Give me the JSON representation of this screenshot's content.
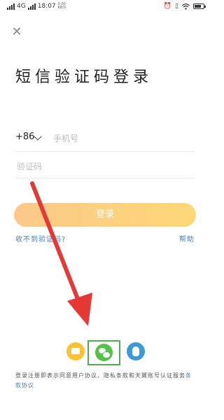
{
  "status_bar": {
    "network": "4G",
    "network_small": "0.00",
    "speed_unit": "KB/S",
    "time": "18:07"
  },
  "title": "短信验证码登录",
  "phone": {
    "country_code": "+86",
    "placeholder": "手机号"
  },
  "code": {
    "placeholder": "验证码"
  },
  "login_button": "登录",
  "links": {
    "no_code": "收不到验证码?",
    "help": "帮助"
  },
  "social": {
    "icons": [
      "mail-icon",
      "wechat-icon",
      "qq-icon"
    ],
    "highlight_color": "#4caf50"
  },
  "agreement": {
    "prefix": "登录注册即表示同意用户协议、隐私条款和天翼账号认证服务",
    "suffix": "条款协议"
  },
  "colors": {
    "accent": "#fdd27f",
    "link": "#4a7fb8",
    "arrow": "#e53935"
  }
}
